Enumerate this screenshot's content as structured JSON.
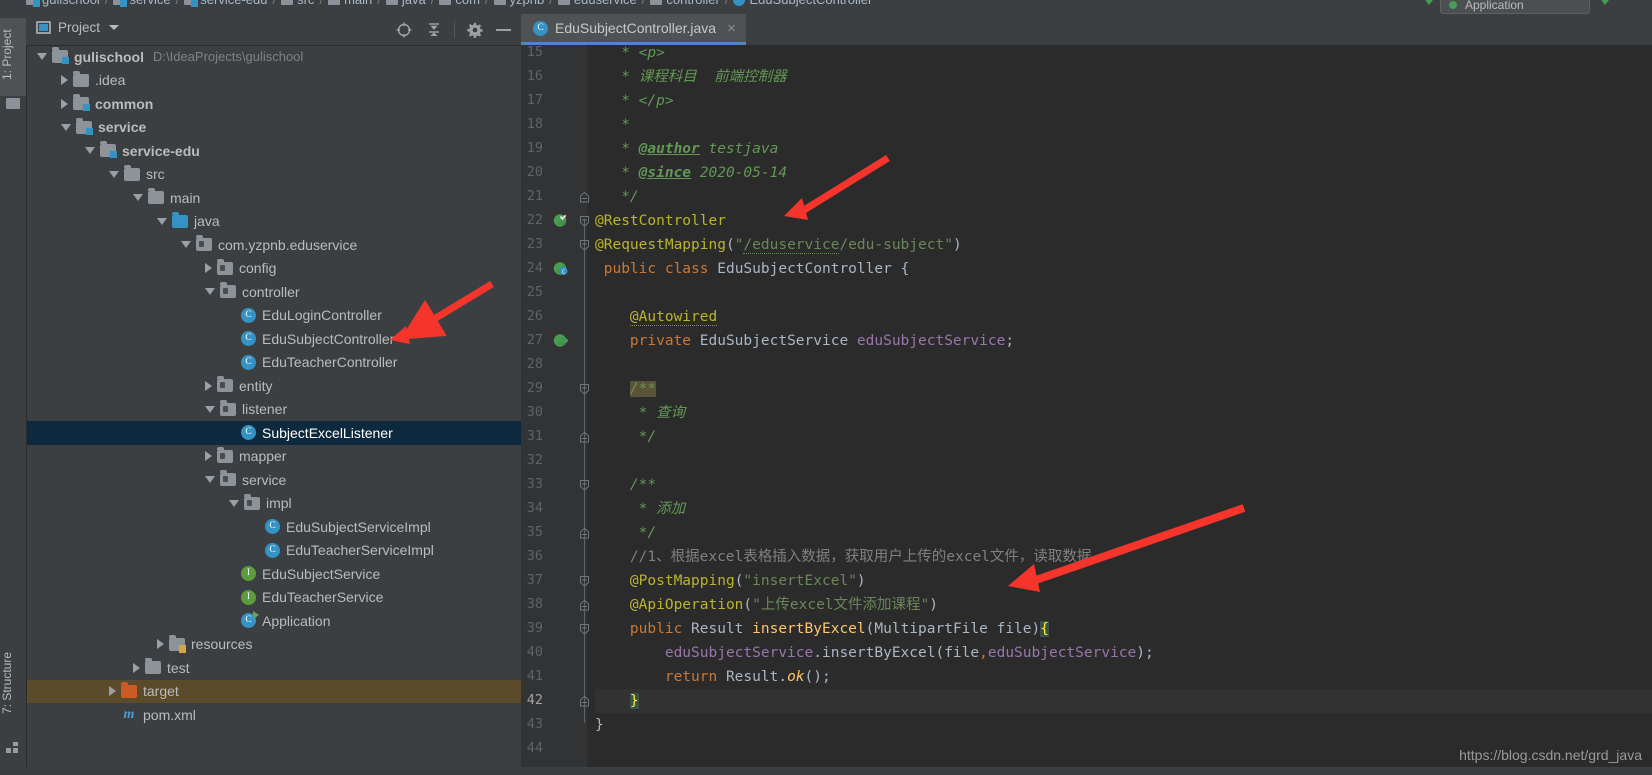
{
  "breadcrumb": {
    "items": [
      "gulischool",
      "service",
      "service-edu",
      "src",
      "main",
      "java",
      "com",
      "yzpnb",
      "eduservice",
      "controller",
      "EduSubjectController"
    ],
    "separator": "/"
  },
  "run_config": {
    "name": "Application"
  },
  "left_strip": {
    "project_tab": "1: Project",
    "structure_tab": "7: Structure"
  },
  "project_panel": {
    "title": "Project",
    "icons": {
      "locate": "crosshair-icon",
      "collapse": "collapse-all-icon",
      "gear": "gear-icon",
      "minimize": "minimize-icon",
      "caret": "chevron-down-icon"
    },
    "tree": [
      {
        "indent": 0,
        "twisty": "open",
        "icon": "module",
        "label": "gulischool",
        "bold": true,
        "path": "D:\\IdeaProjects\\gulischool",
        "state": "normal"
      },
      {
        "indent": 1,
        "twisty": "closed",
        "icon": "folder",
        "label": ".idea",
        "bold": false,
        "path": "",
        "state": "normal"
      },
      {
        "indent": 1,
        "twisty": "closed",
        "icon": "module",
        "label": "common",
        "bold": true,
        "path": "",
        "state": "normal"
      },
      {
        "indent": 1,
        "twisty": "open",
        "icon": "module",
        "label": "service",
        "bold": true,
        "path": "",
        "state": "normal"
      },
      {
        "indent": 2,
        "twisty": "open",
        "icon": "module",
        "label": "service-edu",
        "bold": true,
        "path": "",
        "state": "normal"
      },
      {
        "indent": 3,
        "twisty": "open",
        "icon": "folder",
        "label": "src",
        "bold": false,
        "path": "",
        "state": "normal"
      },
      {
        "indent": 4,
        "twisty": "open",
        "icon": "folder",
        "label": "main",
        "bold": false,
        "path": "",
        "state": "normal"
      },
      {
        "indent": 5,
        "twisty": "open",
        "icon": "src",
        "label": "java",
        "bold": false,
        "path": "",
        "state": "normal"
      },
      {
        "indent": 6,
        "twisty": "open",
        "icon": "package",
        "label": "com.yzpnb.eduservice",
        "bold": false,
        "path": "",
        "state": "normal"
      },
      {
        "indent": 7,
        "twisty": "closed",
        "icon": "package",
        "label": "config",
        "bold": false,
        "path": "",
        "state": "normal"
      },
      {
        "indent": 7,
        "twisty": "open",
        "icon": "package",
        "label": "controller",
        "bold": false,
        "path": "",
        "state": "normal"
      },
      {
        "indent": 8,
        "twisty": "none",
        "icon": "class",
        "label": "EduLoginController",
        "bold": false,
        "path": "",
        "state": "normal"
      },
      {
        "indent": 8,
        "twisty": "none",
        "icon": "class",
        "label": "EduSubjectController",
        "bold": false,
        "path": "",
        "state": "normal"
      },
      {
        "indent": 8,
        "twisty": "none",
        "icon": "class",
        "label": "EduTeacherController",
        "bold": false,
        "path": "",
        "state": "normal"
      },
      {
        "indent": 7,
        "twisty": "closed",
        "icon": "package",
        "label": "entity",
        "bold": false,
        "path": "",
        "state": "normal"
      },
      {
        "indent": 7,
        "twisty": "open",
        "icon": "package",
        "label": "listener",
        "bold": false,
        "path": "",
        "state": "normal"
      },
      {
        "indent": 8,
        "twisty": "none",
        "icon": "class",
        "label": "SubjectExcelListener",
        "bold": false,
        "path": "",
        "state": "selected"
      },
      {
        "indent": 7,
        "twisty": "closed",
        "icon": "package",
        "label": "mapper",
        "bold": false,
        "path": "",
        "state": "normal"
      },
      {
        "indent": 7,
        "twisty": "open",
        "icon": "package",
        "label": "service",
        "bold": false,
        "path": "",
        "state": "normal"
      },
      {
        "indent": 8,
        "twisty": "open",
        "icon": "package",
        "label": "impl",
        "bold": false,
        "path": "",
        "state": "normal"
      },
      {
        "indent": 9,
        "twisty": "none",
        "icon": "class",
        "label": "EduSubjectServiceImpl",
        "bold": false,
        "path": "",
        "state": "normal"
      },
      {
        "indent": 9,
        "twisty": "none",
        "icon": "class",
        "label": "EduTeacherServiceImpl",
        "bold": false,
        "path": "",
        "state": "normal"
      },
      {
        "indent": 8,
        "twisty": "none",
        "icon": "interface",
        "label": "EduSubjectService",
        "bold": false,
        "path": "",
        "state": "normal"
      },
      {
        "indent": 8,
        "twisty": "none",
        "icon": "interface",
        "label": "EduTeacherService",
        "bold": false,
        "path": "",
        "state": "normal"
      },
      {
        "indent": 8,
        "twisty": "none",
        "icon": "app",
        "label": "Application",
        "bold": false,
        "path": "",
        "state": "normal"
      },
      {
        "indent": 5,
        "twisty": "closed",
        "icon": "resources",
        "label": "resources",
        "bold": false,
        "path": "",
        "state": "normal"
      },
      {
        "indent": 4,
        "twisty": "closed",
        "icon": "folder",
        "label": "test",
        "bold": false,
        "path": "",
        "state": "normal"
      },
      {
        "indent": 3,
        "twisty": "closed",
        "icon": "target",
        "label": "target",
        "bold": false,
        "path": "",
        "state": "highlight"
      },
      {
        "indent": 3,
        "twisty": "none",
        "icon": "maven",
        "label": "pom.xml",
        "bold": false,
        "path": "",
        "state": "normal"
      }
    ]
  },
  "editor": {
    "tab": {
      "label": "EduSubjectController.java",
      "icon_letter": "C",
      "close": "×"
    },
    "first_visible_line": 15,
    "current_line": 42,
    "gutter_icons": [
      {
        "line": 22,
        "name": "bean-candidate-icon"
      },
      {
        "line": 24,
        "name": "spring-bean-icon"
      },
      {
        "line": 27,
        "name": "autowired-dependency-icon"
      }
    ],
    "lines": [
      {
        "n": 15,
        "fold": "",
        "segments": [
          {
            "t": "   * ",
            "c": "cm"
          },
          {
            "t": "<p>",
            "c": "cm"
          }
        ]
      },
      {
        "n": 16,
        "fold": "",
        "segments": [
          {
            "t": "   * ",
            "c": "cm"
          },
          {
            "t": "课程科目  前端控制器",
            "c": "cm"
          }
        ]
      },
      {
        "n": 17,
        "fold": "",
        "segments": [
          {
            "t": "   * ",
            "c": "cm"
          },
          {
            "t": "</p>",
            "c": "cm"
          }
        ]
      },
      {
        "n": 18,
        "fold": "",
        "segments": [
          {
            "t": "   *",
            "c": "cm"
          }
        ]
      },
      {
        "n": 19,
        "fold": "",
        "segments": [
          {
            "t": "   * ",
            "c": "cm"
          },
          {
            "t": "@author",
            "c": "cm-tag"
          },
          {
            "t": " testjava",
            "c": "cm"
          }
        ]
      },
      {
        "n": 20,
        "fold": "",
        "segments": [
          {
            "t": "   * ",
            "c": "cm"
          },
          {
            "t": "@since",
            "c": "cm-tag"
          },
          {
            "t": " 2020-05-14",
            "c": "cm"
          }
        ]
      },
      {
        "n": 21,
        "fold": "end",
        "segments": [
          {
            "t": "   */",
            "c": "cm"
          }
        ]
      },
      {
        "n": 22,
        "fold": "start",
        "segments": [
          {
            "t": "@RestController",
            "c": "ann"
          }
        ]
      },
      {
        "n": 23,
        "fold": "start",
        "segments": [
          {
            "t": "@RequestMapping",
            "c": "ann"
          },
          {
            "t": "(",
            "c": "pl"
          },
          {
            "t": "\"",
            "c": "str"
          },
          {
            "t": "/eduservice",
            "c": "str squiggle"
          },
          {
            "t": "/edu-subject\"",
            "c": "str"
          },
          {
            "t": ")",
            "c": "pl"
          }
        ]
      },
      {
        "n": 24,
        "fold": "",
        "segments": [
          {
            "t": " ",
            "c": "pl"
          },
          {
            "t": "public class ",
            "c": "kw"
          },
          {
            "t": "EduSubjectController ",
            "c": "cls"
          },
          {
            "t": "{",
            "c": "pl"
          }
        ]
      },
      {
        "n": 25,
        "fold": "",
        "segments": []
      },
      {
        "n": 26,
        "fold": "",
        "segments": [
          {
            "t": "    ",
            "c": "pl"
          },
          {
            "t": "@Autowired",
            "c": "ann squiggle-y"
          }
        ]
      },
      {
        "n": 27,
        "fold": "",
        "segments": [
          {
            "t": "    ",
            "c": "pl"
          },
          {
            "t": "private ",
            "c": "kw"
          },
          {
            "t": "EduSubjectService ",
            "c": "cls"
          },
          {
            "t": "eduSubjectService",
            "c": "fld"
          },
          {
            "t": ";",
            "c": "pl"
          }
        ]
      },
      {
        "n": 28,
        "fold": "",
        "segments": []
      },
      {
        "n": 29,
        "fold": "start",
        "segments": [
          {
            "t": "    ",
            "c": "pl"
          },
          {
            "t": "/**",
            "c": "cm tok-hl"
          }
        ]
      },
      {
        "n": 30,
        "fold": "",
        "segments": [
          {
            "t": "     * ",
            "c": "cm"
          },
          {
            "t": "查询",
            "c": "cm"
          }
        ]
      },
      {
        "n": 31,
        "fold": "end",
        "segments": [
          {
            "t": "     */",
            "c": "cm"
          }
        ]
      },
      {
        "n": 32,
        "fold": "",
        "segments": []
      },
      {
        "n": 33,
        "fold": "start",
        "segments": [
          {
            "t": "    ",
            "c": "pl"
          },
          {
            "t": "/**",
            "c": "cm"
          }
        ]
      },
      {
        "n": 34,
        "fold": "",
        "segments": [
          {
            "t": "     * ",
            "c": "cm"
          },
          {
            "t": "添加",
            "c": "cm"
          }
        ]
      },
      {
        "n": 35,
        "fold": "end",
        "segments": [
          {
            "t": "     */",
            "c": "cm"
          }
        ]
      },
      {
        "n": 36,
        "fold": "",
        "segments": [
          {
            "t": "    ",
            "c": "pl"
          },
          {
            "t": "//1、根据excel表格插入数据，获取用户上传的excel文件，读取数据",
            "c": "lcm"
          }
        ]
      },
      {
        "n": 37,
        "fold": "start",
        "segments": [
          {
            "t": "    ",
            "c": "pl"
          },
          {
            "t": "@PostMapping",
            "c": "ann"
          },
          {
            "t": "(",
            "c": "pl"
          },
          {
            "t": "\"insertExcel\"",
            "c": "str"
          },
          {
            "t": ")",
            "c": "pl"
          }
        ]
      },
      {
        "n": 38,
        "fold": "end",
        "segments": [
          {
            "t": "    ",
            "c": "pl"
          },
          {
            "t": "@ApiOperation",
            "c": "ann"
          },
          {
            "t": "(",
            "c": "pl"
          },
          {
            "t": "\"上传excel文件添加课程\"",
            "c": "str"
          },
          {
            "t": ")",
            "c": "pl"
          }
        ]
      },
      {
        "n": 39,
        "fold": "start",
        "segments": [
          {
            "t": "    ",
            "c": "pl"
          },
          {
            "t": "public ",
            "c": "kw"
          },
          {
            "t": "Result ",
            "c": "cls"
          },
          {
            "t": "insertByExcel",
            "c": "mth"
          },
          {
            "t": "(",
            "c": "pl"
          },
          {
            "t": "MultipartFile ",
            "c": "cls"
          },
          {
            "t": "file",
            "c": "pl"
          },
          {
            "t": ")",
            "c": "pl"
          },
          {
            "t": "{",
            "c": "brace-hl"
          }
        ]
      },
      {
        "n": 40,
        "fold": "",
        "segments": [
          {
            "t": "        ",
            "c": "pl"
          },
          {
            "t": "eduSubjectService",
            "c": "fld"
          },
          {
            "t": ".insertByExcel(",
            "c": "pl"
          },
          {
            "t": "file",
            "c": "pl"
          },
          {
            "t": ",",
            "c": "kw"
          },
          {
            "t": "eduSubjectService",
            "c": "fld"
          },
          {
            "t": ");",
            "c": "pl"
          }
        ]
      },
      {
        "n": 41,
        "fold": "",
        "segments": [
          {
            "t": "        ",
            "c": "pl"
          },
          {
            "t": "return ",
            "c": "kw"
          },
          {
            "t": "Result.",
            "c": "cls"
          },
          {
            "t": "ok",
            "c": "mth ital"
          },
          {
            "t": "();",
            "c": "pl"
          }
        ]
      },
      {
        "n": 42,
        "fold": "end",
        "segments": [
          {
            "t": "    ",
            "c": "pl"
          },
          {
            "t": "}",
            "c": "brace-hl"
          }
        ]
      },
      {
        "n": 43,
        "fold": "",
        "segments": [
          {
            "t": "}",
            "c": "pl"
          }
        ]
      },
      {
        "n": 44,
        "fold": "",
        "segments": []
      }
    ]
  },
  "annotations": {
    "arrows": [
      {
        "name": "arrow-to-edusubjectcontroller-node"
      },
      {
        "name": "arrow-to-request-mapping"
      },
      {
        "name": "arrow-to-api-operation"
      }
    ]
  },
  "watermark": {
    "text": "https://blog.csdn.net/grd_java"
  },
  "colors": {
    "accent_blue": "#3592c4",
    "selection_blue": "#0d293e",
    "editor_bg": "#2b2b2b",
    "panel_bg": "#3c3f41",
    "arrow_red": "#f5352c",
    "string_green": "#6a8759",
    "comment_green": "#629755",
    "annotation_yellow": "#bbb529",
    "keyword_orange": "#cc7832",
    "field_purple": "#9876aa"
  }
}
